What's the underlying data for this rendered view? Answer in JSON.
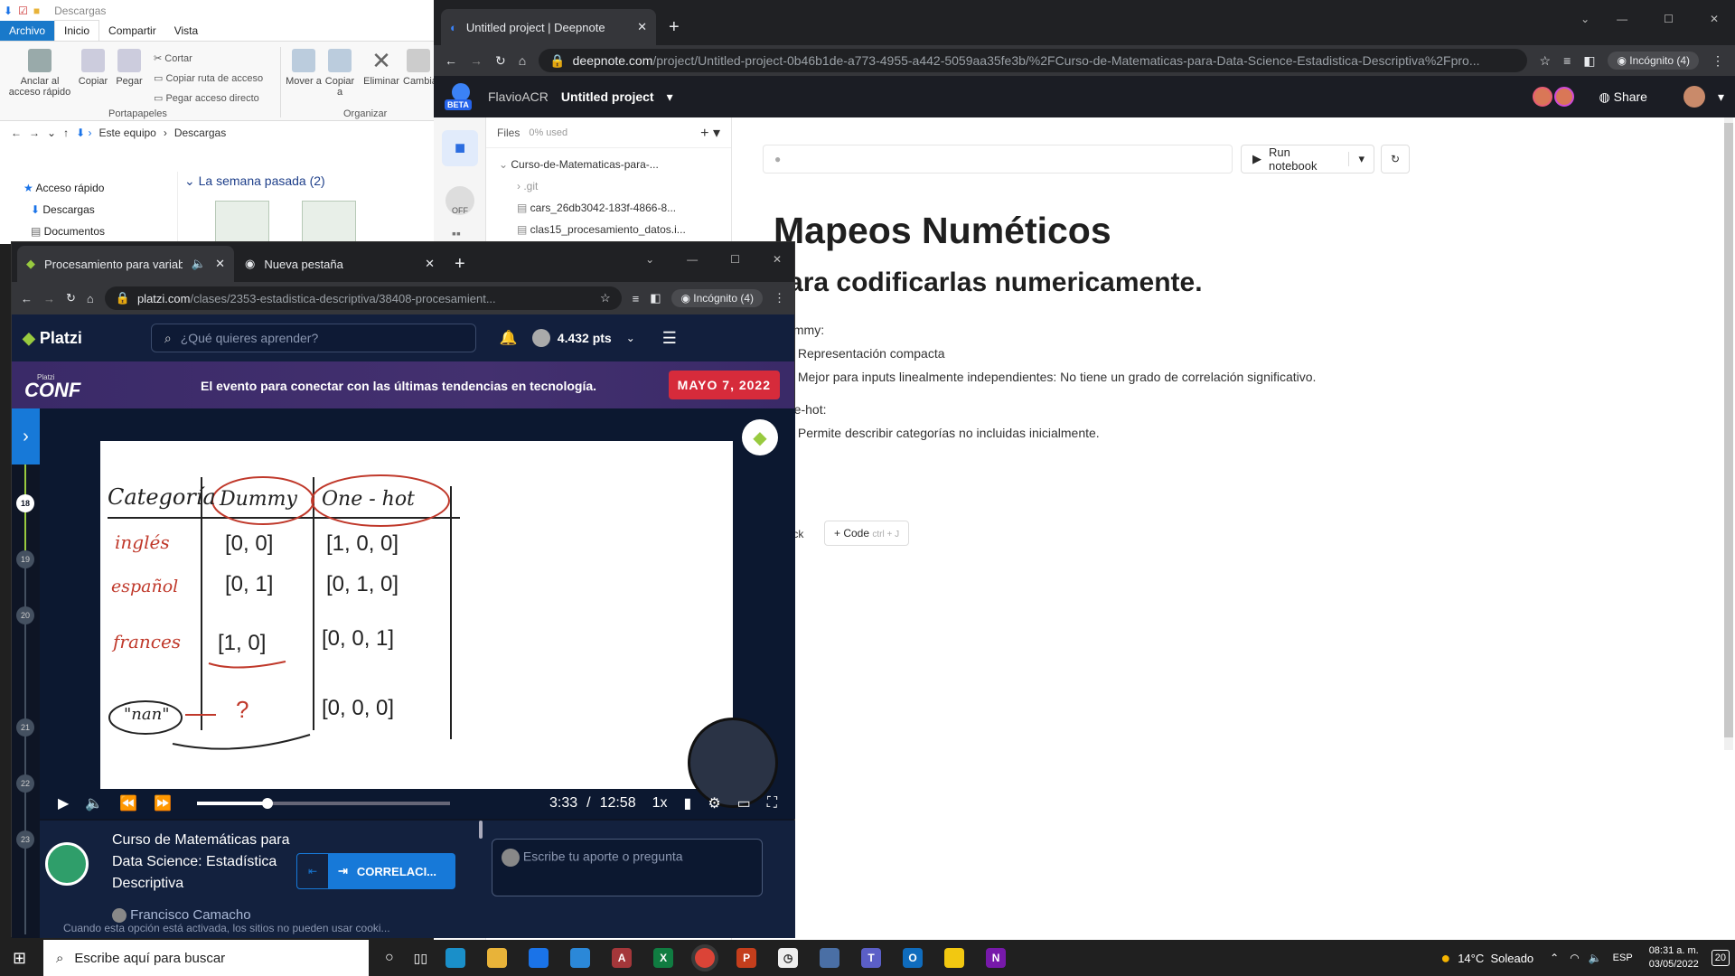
{
  "explorer": {
    "qat_title": "Descargas",
    "tabs": [
      "Archivo",
      "Inicio",
      "Compartir",
      "Vista"
    ],
    "ribbon": {
      "pin_label": "Anclar al acceso rápido",
      "copy_label": "Copiar",
      "paste_label": "Pegar",
      "cut_label": "Cortar",
      "copy_path_label": "Copiar ruta de acceso",
      "paste_shortcut_label": "Pegar acceso directo",
      "clipboard_group": "Portapapeles",
      "move_label": "Mover a",
      "copy_to_label": "Copiar a",
      "delete_label": "Eliminar",
      "rename_label": "Cambiar nombre",
      "organize_group": "Organizar"
    },
    "breadcrumb": [
      "Este equipo",
      "Descargas"
    ],
    "nav": [
      "Acceso rápido",
      "Descargas",
      "Documentos"
    ],
    "group_header": "La semana pasada (2)"
  },
  "deepnote_browser": {
    "tab_title": "Untitled project | Deepnote",
    "url_host": "deepnote.com",
    "url_path": "/project/Untitled-project-0b46b1de-a773-4955-a442-5059aa35fe3b/%2FCurso-de-Matematicas-para-Data-Science-Estadistica-Descriptiva%2Fpro...",
    "incognito_label": "Incógnito (4)"
  },
  "deepnote": {
    "beta_badge": "BETA",
    "workspace": "FlavioACR",
    "project": "Untitled project",
    "share_label": "Share",
    "files_label": "Files",
    "usage": "0% used",
    "side_off_label": "OFF",
    "tree": [
      "Curso-de-Matematicas-para-...",
      ".git",
      "cars_26db3042-183f-4866-8...",
      "clas15_procesamiento_datos.i..."
    ],
    "run_label": "Run notebook",
    "h1": "Mapeos Numéticos",
    "h2": "Para codificarlas numericamente.",
    "dummy_label": "Dummy:",
    "dummy_points": [
      "Representación compacta",
      "Mejor para inputs linealmente independientes: No tiene un grado de correlación significativo."
    ],
    "onehot_label": "One-hot:",
    "onehot_points": [
      "Permite describir categorías no incluidas inicialmente."
    ],
    "block_btn": "Block",
    "code_btn": "+ Code",
    "code_shortcut": "ctrl + J"
  },
  "platzi_browser": {
    "tab1": "Procesamiento para variable",
    "tab2": "Nueva pestaña",
    "url_host": "platzi.com",
    "url_path": "/clases/2353-estadistica-descriptiva/38408-procesamient...",
    "incognito_label": "Incógnito (4)"
  },
  "platzi": {
    "logo": "Platzi",
    "search_placeholder": "¿Qué quieres aprender?",
    "points": "4.432 pts",
    "banner_logo_small": "Platzi",
    "banner_logo": "CONF",
    "banner_text": "El evento para conectar con las últimas tendencias en tecnología.",
    "banner_date": "MAYO 7, 2022",
    "timeline": [
      "18",
      "19",
      "20",
      "21",
      "22",
      "23"
    ],
    "whiteboard": {
      "headers": [
        "Categoría",
        "Dummy",
        "One - hot"
      ],
      "rows": [
        [
          "inglés",
          "[0, 0]",
          "[1, 0, 0]"
        ],
        [
          "español",
          "[0, 1]",
          "[0, 1, 0]"
        ],
        [
          "frances",
          "[1, 0]",
          "[0, 0, 1]"
        ],
        [
          "\"nan\"",
          "?",
          "[0, 0, 0]"
        ]
      ]
    },
    "time_current": "3:33",
    "time_sep": "/",
    "time_total": "12:58",
    "speed": "1x",
    "progress": 0.28,
    "course_title": "Curso de Matemáticas para Data Science: Estadística Descriptiva",
    "teacher": "Francisco Camacho",
    "next_btn": "CORRELACI...",
    "comment_placeholder": "Escribe tu aporte o pregunta",
    "cookie_notice": "Cuando esta opción está activada, los sitios no pueden usar cooki..."
  },
  "taskbar": {
    "search_placeholder": "Escribe aquí para buscar",
    "weather": "14°C  Soleado",
    "lang": "ESP",
    "time": "08:31 a. m.",
    "date": "03/05/2022",
    "notif_count": "20"
  }
}
